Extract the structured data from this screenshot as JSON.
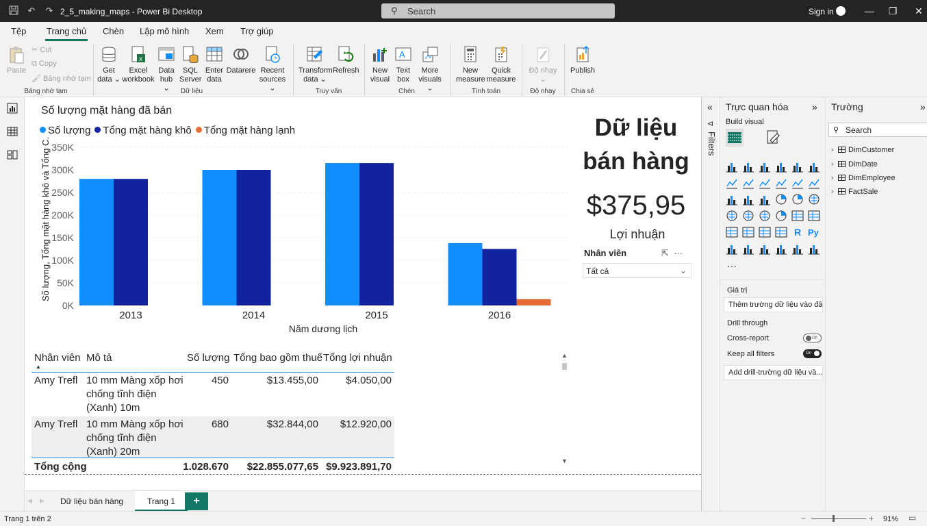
{
  "window": {
    "title": "2_5_making_maps - Power Bi Desktop",
    "search_placeholder": "Search",
    "sign_in": "Sign in"
  },
  "menu": {
    "tabs": [
      "Tệp",
      "Trang chủ",
      "Chèn",
      "Lập mô hình",
      "Xem",
      "Trợ giúp"
    ],
    "active": "Trang chủ"
  },
  "ribbon": {
    "clipboard": {
      "paste": "Paste",
      "cut": "Cut",
      "copy": "Copy",
      "format_painter": "Bảng nhớ tạm",
      "group": "Bảng nhớ tạm"
    },
    "data": {
      "get_data": [
        "Get",
        "data ⌄"
      ],
      "excel": [
        "Excel",
        "workbook"
      ],
      "data_hub": [
        "Data",
        "hub ⌄"
      ],
      "sql": [
        "SQL",
        "Server"
      ],
      "enter": [
        "Enter",
        "data"
      ],
      "datarere": [
        "Datarere",
        ""
      ],
      "recent": [
        "Recent",
        "sources ⌄"
      ],
      "group": "Dữ liệu"
    },
    "query": {
      "transform": [
        "Transform",
        "data ⌄"
      ],
      "refresh": [
        "Refresh",
        ""
      ],
      "group": "Truy vấn"
    },
    "insert": {
      "new_visual": [
        "New",
        "visual"
      ],
      "text_box": [
        "Text",
        "box"
      ],
      "more_visuals": [
        "More",
        "visuals ⌄"
      ],
      "group": "Chèn"
    },
    "calc": {
      "new_measure": [
        "New",
        "measure"
      ],
      "quick_measure": [
        "Quick",
        "measure"
      ],
      "group": "Tính toán"
    },
    "sensitivity": {
      "label": [
        "Độ nhạy",
        "⌄"
      ],
      "group": "Độ nhạy"
    },
    "share": {
      "publish": "Publish",
      "group": "Chia sẻ"
    }
  },
  "chart": {
    "title": "Số lượng mặt hàng đã bán",
    "legend": [
      {
        "name": "Số lượng",
        "color": "#118dff"
      },
      {
        "name": "Tổng mặt hàng khô",
        "color": "#12239e"
      },
      {
        "name": "Tổng mặt hàng lạnh",
        "color": "#e66c37"
      }
    ],
    "ylabel": "Số lượng, Tổng mặt hàng khô và Tổng C...",
    "xlabel": "Năm dương lịch"
  },
  "chart_data": {
    "type": "bar",
    "title": "Số lượng mặt hàng đã bán",
    "xlabel": "Năm dương lịch",
    "ylabel": "Số lượng, Tổng mặt hàng khô và Tổng C...",
    "categories": [
      "2013",
      "2014",
      "2015",
      "2016"
    ],
    "series": [
      {
        "name": "Số lượng",
        "color": "#118dff",
        "values": [
          280000,
          300000,
          315000,
          138000
        ]
      },
      {
        "name": "Tổng mặt hàng khô",
        "color": "#12239e",
        "values": [
          280000,
          300000,
          315000,
          125000
        ]
      },
      {
        "name": "Tổng mặt hàng lạnh",
        "color": "#e66c37",
        "values": [
          0,
          0,
          0,
          14000
        ]
      }
    ],
    "ylim": [
      0,
      350000
    ],
    "yticks": [
      "0K",
      "50K",
      "100K",
      "150K",
      "200K",
      "250K",
      "300K",
      "350K"
    ],
    "grid": true,
    "legend_position": "top-left"
  },
  "report": {
    "big_title": "Dữ liệu bán hàng",
    "kpi_value": "$375,95",
    "kpi_label": "Lợi nhuận"
  },
  "slicer": {
    "title": "Nhân viên",
    "value": "Tất cả"
  },
  "table": {
    "headers": [
      "Nhân viên",
      "Mô tả",
      "Số lượng",
      "Tổng bao gồm thuế",
      "Tổng lợi nhuận"
    ],
    "rows": [
      {
        "employee": "Amy Trefl",
        "desc": [
          "10 mm Màng xốp hơi",
          "chống tĩnh điện",
          "(Xanh) 10m"
        ],
        "qty": "450",
        "total_tax": "$13.455,00",
        "profit": "$4.050,00"
      },
      {
        "employee": "Amy Trefl",
        "desc": [
          "10 mm Màng xốp hơi",
          "chống tĩnh điện",
          "(Xanh) 20m"
        ],
        "qty": "680",
        "total_tax": "$32.844,00",
        "profit": "$12.920,00"
      }
    ],
    "total": {
      "label": "Tổng cộng",
      "qty": "1.028.670",
      "total_tax": "$22.855.077,65",
      "profit": "$9.923.891,70"
    }
  },
  "pages": {
    "tabs": [
      "Dữ liệu bán hàng",
      "Trang 1"
    ],
    "active": "Trang 1",
    "add": "+"
  },
  "status": {
    "page": "Trang 1 trên 2",
    "zoom": "91%",
    "zoom_level_percent": 91
  },
  "filters": {
    "label": "Filters"
  },
  "visualizations": {
    "title": "Trực quan hóa",
    "build": "Build visual",
    "more": "···",
    "values_label": "Giá trị",
    "values_well": "Thêm trường dữ liệu vào đây",
    "drill_label": "Drill through",
    "cross_report": "Cross-report",
    "cross_report_state": "Off",
    "keep_filters": "Keep all filters",
    "keep_filters_state": "On",
    "drill_well": "Add drill-trường dữ liệu và..."
  },
  "fields": {
    "title": "Trường",
    "search_placeholder": "Search",
    "tables": [
      "DimCustomer",
      "DimDate",
      "DimEmployee",
      "FactSale"
    ]
  }
}
